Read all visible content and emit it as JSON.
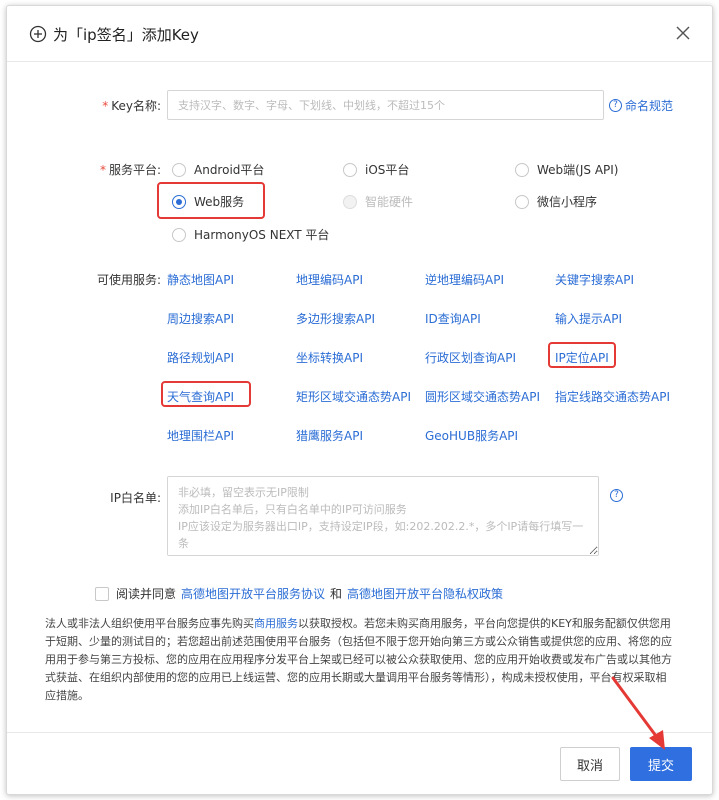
{
  "dialog": {
    "title": "为「ip签名」添加Key",
    "close_label": "×"
  },
  "key_name": {
    "label": "Key名称:",
    "required_mark": "*",
    "placeholder": "支持汉字、数字、字母、下划线、中划线，不超过15个",
    "help_link": "命名规范"
  },
  "platform": {
    "label": "服务平台:",
    "required_mark": "*",
    "options": [
      {
        "label": "Android平台",
        "state": "unchecked"
      },
      {
        "label": "iOS平台",
        "state": "unchecked"
      },
      {
        "label": "Web端(JS API)",
        "state": "unchecked"
      },
      {
        "label": "Web服务",
        "state": "checked"
      },
      {
        "label": "智能硬件",
        "state": "disabled"
      },
      {
        "label": "微信小程序",
        "state": "unchecked"
      },
      {
        "label": "HarmonyOS NEXT 平台",
        "state": "unchecked"
      }
    ]
  },
  "services": {
    "label": "可使用服务:",
    "items": [
      "静态地图API",
      "地理编码API",
      "逆地理编码API",
      "关键字搜索API",
      "周边搜索API",
      "多边形搜索API",
      "ID查询API",
      "输入提示API",
      "路径规划API",
      "坐标转换API",
      "行政区划查询API",
      "IP定位API",
      "天气查询API",
      "矩形区域交通态势API",
      "圆形区域交通态势API",
      "指定线路交通态势API",
      "地理围栏API",
      "猎鹰服务API",
      "GeoHUB服务API"
    ]
  },
  "ip_whitelist": {
    "label": "IP白名单:",
    "placeholder": "非必填，留空表示无IP限制\n添加IP白名单后，只有白名单中的IP可访问服务\nIP应该设定为服务器出口IP，支持设定IP段，如:202.202.2.*，多个IP请每行填写一条"
  },
  "agreement": {
    "prefix": "阅读并同意",
    "link1": "高德地图开放平台服务协议",
    "joiner": "和",
    "link2": "高德地图开放平台隐私权政策"
  },
  "notice": {
    "part1": "法人或非法人组织使用平台服务应事先购买",
    "link": "商用服务",
    "part2": "以获取授权。若您未购买商用服务，平台向您提供的KEY和服务配额仅供您用于短期、少量的测试目的；若您超出前述范围使用平台服务（包括但不限于您开始向第三方或公众销售或提供您的应用、将您的应用用于参与第三方投标、您的应用在应用程序分发平台上架或已经可以被公众获取使用、您的应用开始收费或发布广告或以其他方式获益、在组织内部使用的您的应用已上线运营、您的应用长期或大量调用平台服务等情形），构成未授权使用，平台有权采取相应措施。"
  },
  "footer": {
    "cancel": "取消",
    "submit": "提交"
  },
  "colors": {
    "accent": "#2b6dd5",
    "primary_button": "#2f6fe0",
    "highlight": "#e53935",
    "required": "#e84b3c"
  }
}
